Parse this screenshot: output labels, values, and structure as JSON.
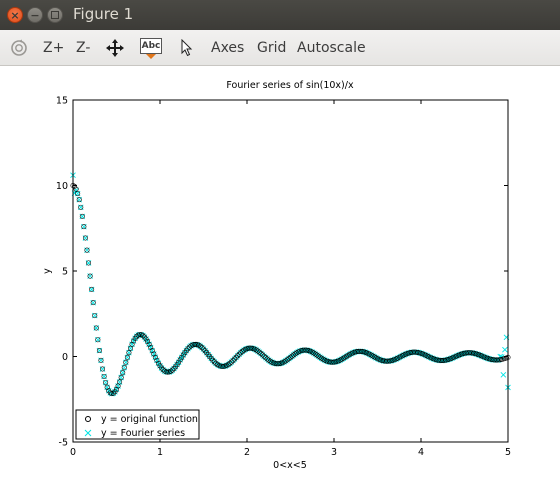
{
  "window": {
    "title": "Figure 1",
    "accent": "#df4a16",
    "titlebar_color": "#3c3b37"
  },
  "toolbar": {
    "rotate_icon": "rotate-icon",
    "zoom_in_label": "Z+",
    "zoom_out_label": "Z-",
    "pan_icon": "pan-icon",
    "text_icon_label": "Abc",
    "select_icon": "pointer-icon",
    "axes_label": "Axes",
    "grid_label": "Grid",
    "autoscale_label": "Autoscale"
  },
  "chart_data": {
    "type": "scatter",
    "title": "Fourier series of sin(10x)/x",
    "xlabel": "0<x<5",
    "ylabel": "y",
    "xlim": [
      0,
      5
    ],
    "ylim": [
      -5,
      15
    ],
    "xticks": [
      "0",
      "1",
      "2",
      "3",
      "4",
      "5"
    ],
    "yticks": [
      "-5",
      "0",
      "5",
      "10",
      "15"
    ],
    "grid": false,
    "legend_position": "bottom-left",
    "series": [
      {
        "name": "y = original function",
        "marker": "circle",
        "color": "#000000",
        "function": "sin(10x)/x",
        "x_range": [
          0,
          5
        ]
      },
      {
        "name": "y = Fourier series",
        "marker": "x",
        "color": "#00e5e5",
        "function": "Fourier series of sin(10x)/x",
        "x_range": [
          0,
          5
        ]
      }
    ]
  }
}
